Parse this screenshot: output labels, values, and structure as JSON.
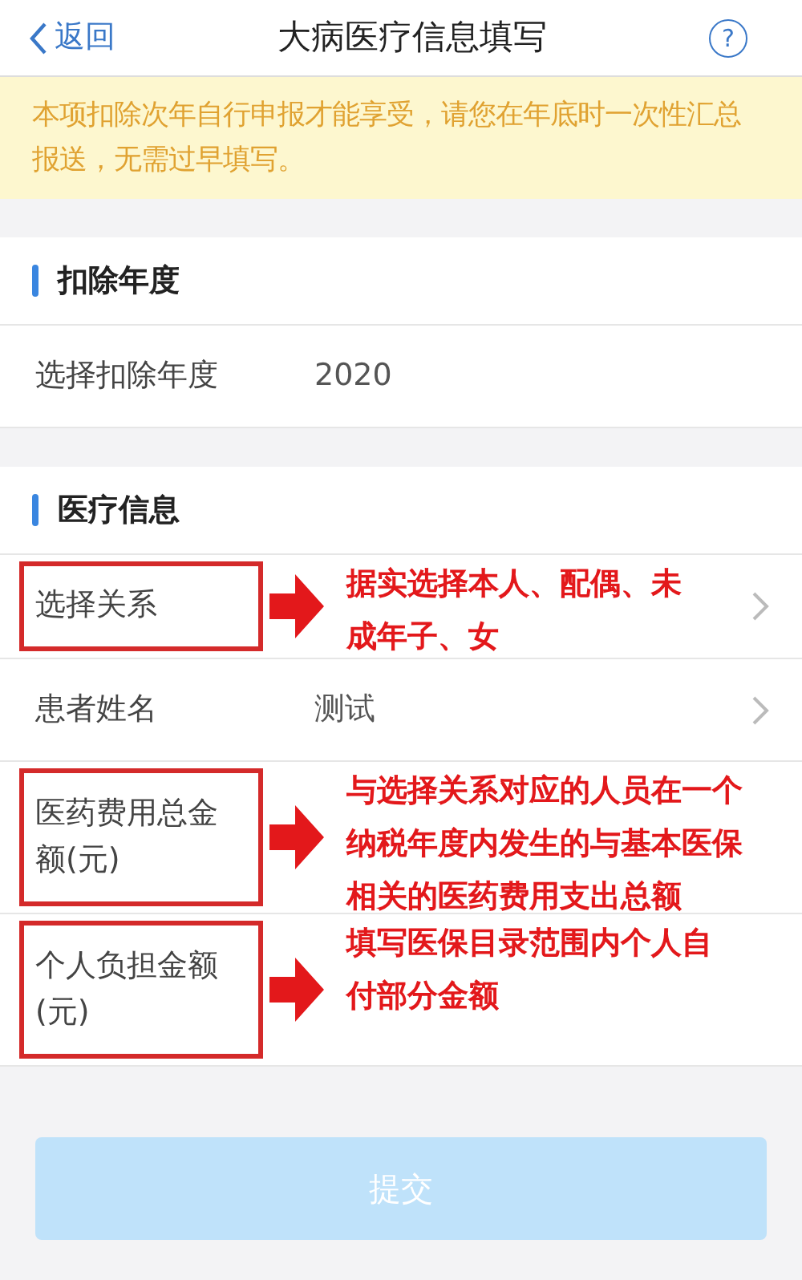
{
  "header": {
    "back_label": "返回",
    "title": "大病医疗信息填写",
    "help_icon": "?"
  },
  "notice": "本项扣除次年自行申报才能享受，请您在年底时一次性汇总报送，无需过早填写。",
  "sections": [
    {
      "title": "扣除年度",
      "rows": [
        {
          "kind": "select",
          "label": "选择扣除年度",
          "value": "2020"
        }
      ]
    },
    {
      "title": "医疗信息",
      "rows": [
        {
          "kind": "select",
          "label": "选择关系",
          "chevron": true,
          "annotation": [
            "据实选择本人、配偶、未",
            "成年子、女"
          ]
        },
        {
          "kind": "select",
          "label": "患者姓名",
          "value": "测试",
          "chevron": true
        },
        {
          "kind": "input",
          "label": "医药费用总金额(元)",
          "annotation": [
            "与选择关系对应的人员在一个",
            "纳税年度内发生的与基本医保",
            "相关的医药费用支出总额"
          ]
        },
        {
          "kind": "input",
          "label": "个人负担金额(元)",
          "annotation": [
            "填写医保目录范围内个人自",
            "付部分金额"
          ]
        }
      ]
    }
  ],
  "submit": {
    "label": "提交",
    "disabled": true
  }
}
